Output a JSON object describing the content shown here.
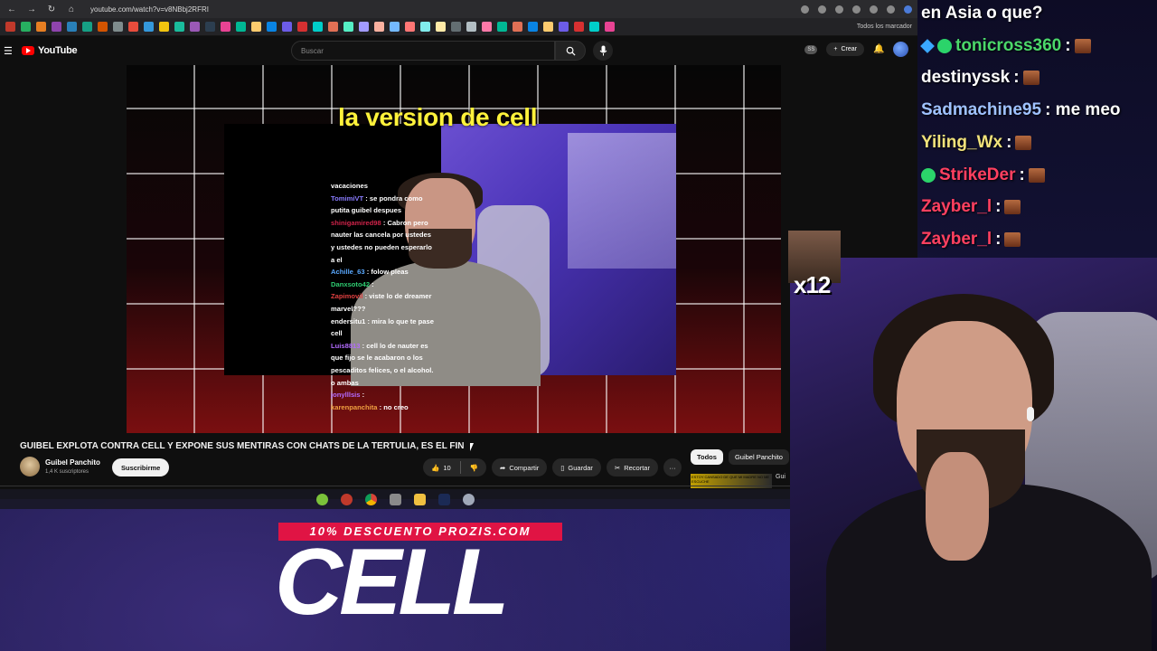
{
  "browser": {
    "url": "youtube.com/watch?v=v8NBbj2RFRI",
    "bookmarks_all": "Todos los marcador"
  },
  "header": {
    "logo_text": "YouTube",
    "search_placeholder": "Buscar",
    "shorts_badge": "SS",
    "create_label": "Crear"
  },
  "video_overlay": {
    "title": "la version de cell",
    "chat": [
      {
        "user": "",
        "text": "vacaciones",
        "color": "#ffffff"
      },
      {
        "user": "TomimiVT",
        "text": "se pondra como putita guibel despues",
        "color": "#8a7cff"
      },
      {
        "user": "shinigamired98",
        "text": "Cabron pero nauter las cancela por ustedes y ustedes no pueden esperarlo a el",
        "color": "#d0234a"
      },
      {
        "user": "Achille_63",
        "text": "folow pleas",
        "color": "#5aa9ff"
      },
      {
        "user": "Danxsoto42",
        "text": "",
        "color": "#2ecc71"
      },
      {
        "user": "Zapimovil",
        "text": "viste lo de dreamer marvel???",
        "color": "#e04040"
      },
      {
        "user": "endersitu1",
        "text": "mira lo que te pase cell",
        "color": "#ffffff"
      },
      {
        "user": "Luis8813",
        "text": "cell lo de nauter es que fijo se le acabaron o los pescaditos felices, o el alcohol. o ambas",
        "color": "#b36bff"
      },
      {
        "user": "jonylllsis",
        "text": "",
        "color": "#b36bff"
      },
      {
        "user": "karenpanchita",
        "text": "no creo",
        "color": "#f0a040"
      }
    ]
  },
  "video": {
    "title": "GUIBEL EXPLOTA CONTRA CELL Y EXPONE SUS MENTIRAS CON CHATS DE LA TERTULIA, ES EL FIN",
    "channel_name": "Guibel Panchito",
    "subscribers": "1,4 K suscriptores",
    "subscribe_label": "Suscribirme",
    "likes": "10",
    "share_label": "Compartir",
    "save_label": "Guardar",
    "clip_label": "Recortar",
    "more_label": "···"
  },
  "filters": {
    "chips": [
      "Todos",
      "Guibel Panchito"
    ]
  },
  "related": {
    "thumb_text": "ESTOY CANSADO DE QUE MI MADRE NO ME ESCUCHE",
    "title_snippet": "Gui"
  },
  "sponsor": {
    "promo": "10% DESCUENTO PROZIS.COM",
    "code": "CELL"
  },
  "stream_chat": [
    {
      "user": "",
      "text": "en Asia o que?",
      "color": "#ffffff",
      "badges": [],
      "emote": false
    },
    {
      "user": "tonicross360",
      "text": ":",
      "color": "#4bd86a",
      "badges": [
        "cube",
        "prime"
      ],
      "emote": true
    },
    {
      "user": "destinyssk",
      "text": ":",
      "color": "#ffffff",
      "badges": [],
      "emote": true
    },
    {
      "user": "Sadmachine95",
      "text": ": me meo",
      "color": "#9fc2ff",
      "badges": [],
      "emote": false
    },
    {
      "user": "Yiling_Wx",
      "text": ":",
      "color": "#f1e27a",
      "badges": [],
      "emote": true
    },
    {
      "user": "StrikeDer",
      "text": ":",
      "color": "#ff4060",
      "badges": [
        "prime"
      ],
      "emote": true
    },
    {
      "user": "Zayber_l",
      "text": ":",
      "color": "#ff4060",
      "badges": [],
      "emote": true
    },
    {
      "user": "Zayber_l",
      "text": ":",
      "color": "#ff4060",
      "badges": [],
      "emote": true
    }
  ],
  "webcam": {
    "multiplier": "x12"
  },
  "colors": {
    "accent_red": "#ff0000",
    "promo_red": "#e01444",
    "title_yellow": "#fff23b"
  }
}
